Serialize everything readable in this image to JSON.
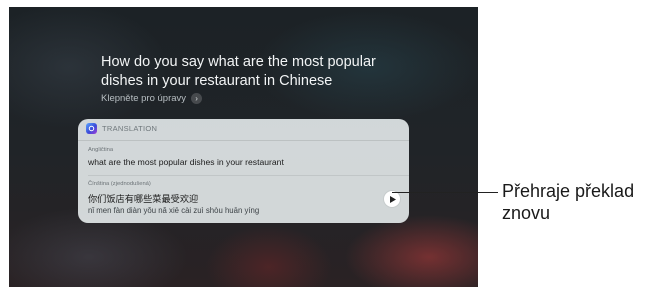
{
  "siri": {
    "query": "How do you say what are the most popular dishes in your restaurant in Chinese",
    "tap_to_edit": "Klepněte pro úpravy"
  },
  "translation_card": {
    "title": "TRANSLATION",
    "source_language": "Angličtina",
    "source_text": "what are the most popular dishes in your restaurant",
    "target_language": "Čínština (zjednodušená)",
    "target_text": "你们饭店有哪些菜最受欢迎",
    "pinyin": "nǐ men fàn diàn yǒu nǎ xiē cài zuì shòu huān yíng"
  },
  "callout": {
    "text": "Přehraje překlad znovu"
  },
  "icons": {
    "app": "translate-app-icon",
    "play": "play-icon",
    "chevron": "chevron-right-icon"
  }
}
